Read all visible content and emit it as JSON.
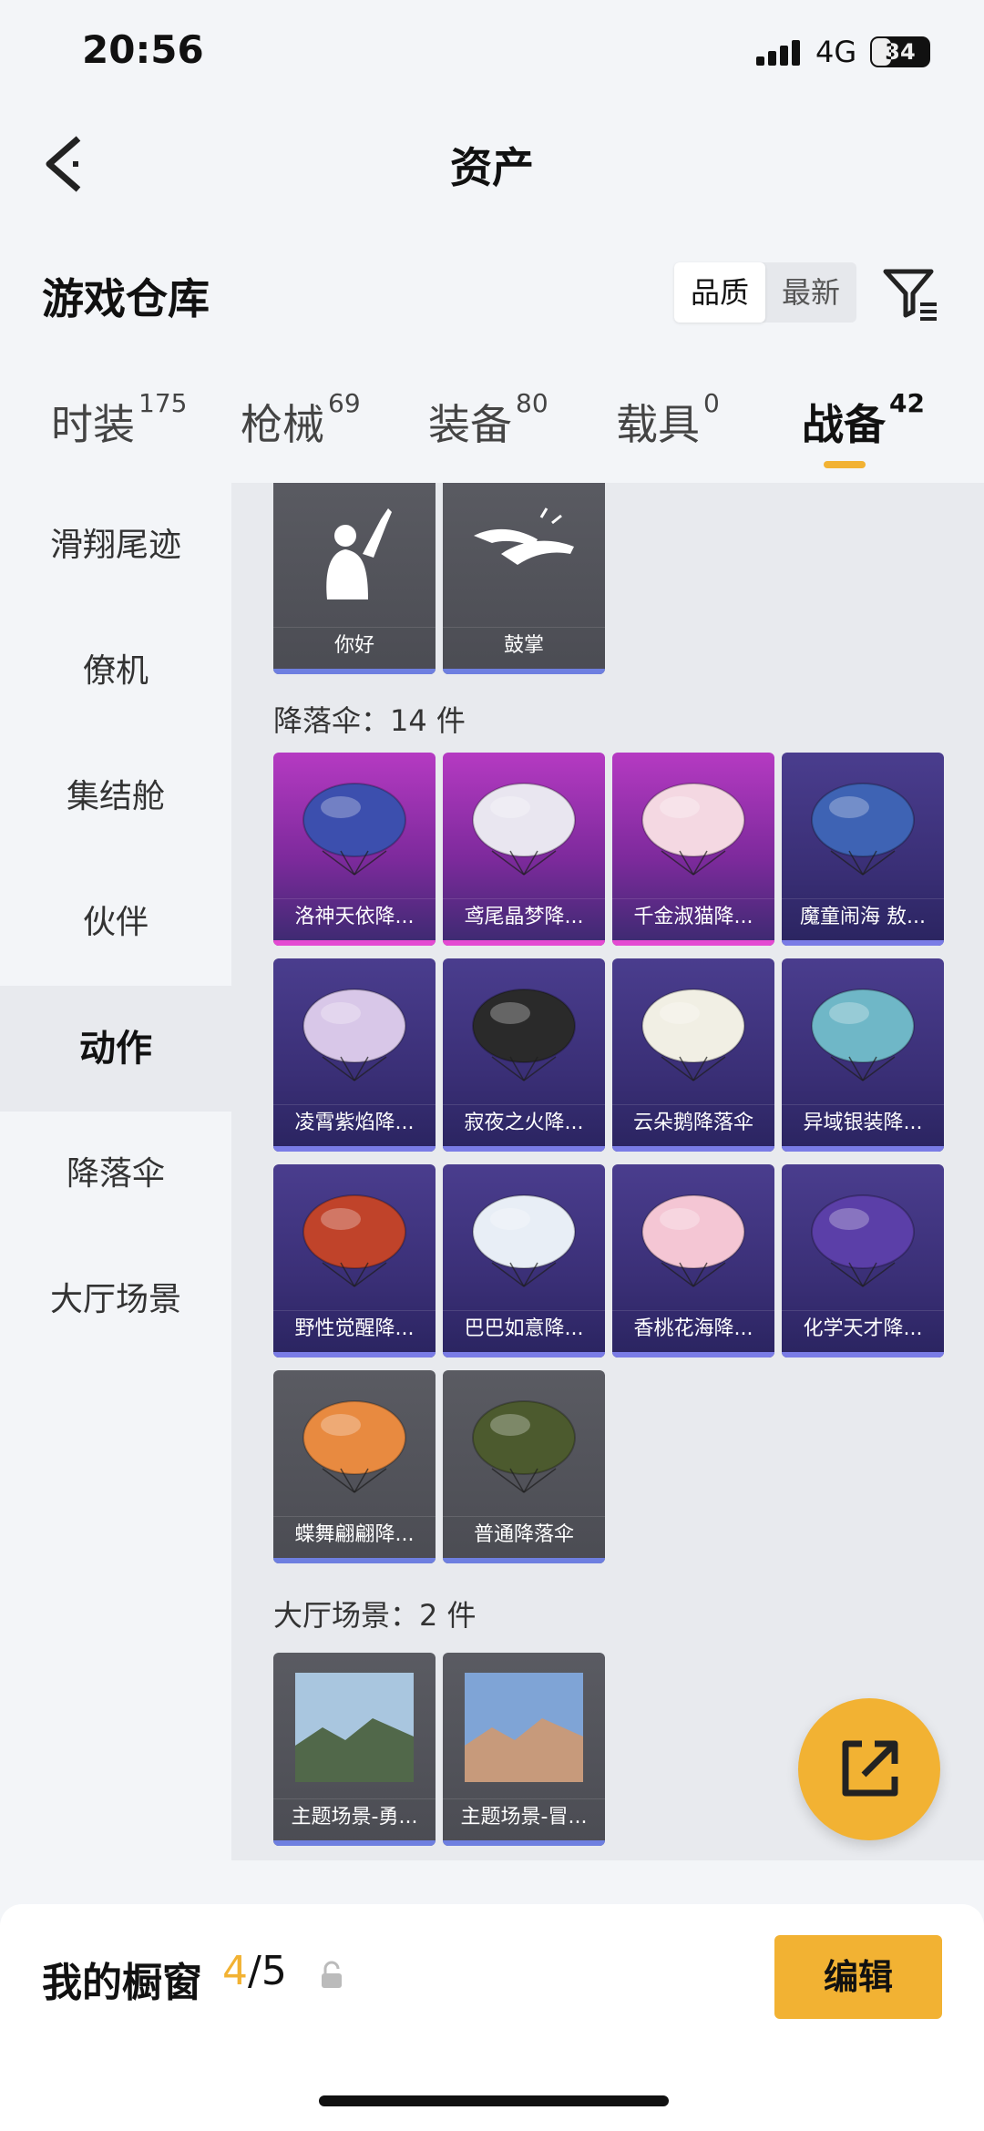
{
  "status": {
    "time": "20:56",
    "network": "4G",
    "battery": "34",
    "battery_level": 0.34
  },
  "nav": {
    "title": "资产",
    "back_icon": "chevron-left-icon"
  },
  "warehouse": {
    "title": "游戏仓库",
    "sort_options": [
      "品质",
      "最新"
    ],
    "sort_selected": "品质",
    "filter_icon": "filter-icon"
  },
  "tabs": [
    {
      "label": "时装",
      "count": "175"
    },
    {
      "label": "枪械",
      "count": "69"
    },
    {
      "label": "装备",
      "count": "80"
    },
    {
      "label": "载具",
      "count": "0"
    },
    {
      "label": "战备",
      "count": "42",
      "active": true
    }
  ],
  "sidebar": [
    {
      "label": "滑翔尾迹"
    },
    {
      "label": "僚机"
    },
    {
      "label": "集结舱"
    },
    {
      "label": "伙伴"
    },
    {
      "label": "动作",
      "active": true
    },
    {
      "label": "降落伞"
    },
    {
      "label": "大厅场景"
    }
  ],
  "actions": [
    {
      "label": "你好",
      "icon": "waving-person-icon"
    },
    {
      "label": "鼓掌",
      "icon": "clapping-hands-icon"
    }
  ],
  "parachutes": {
    "header": "降落伞：14 件",
    "items": [
      {
        "label": "洛神天依降...",
        "rarity": "purple",
        "color": "#3c4fae"
      },
      {
        "label": "鸢尾晶梦降...",
        "rarity": "purple",
        "color": "#e9e6f0"
      },
      {
        "label": "千金淑猫降...",
        "rarity": "purple",
        "color": "#f4d8e2"
      },
      {
        "label": "魔童闹海 敖...",
        "rarity": "blue",
        "color": "#3e63b4"
      },
      {
        "label": "凌霄紫焰降...",
        "rarity": "blue",
        "color": "#d8c7e8"
      },
      {
        "label": "寂夜之火降...",
        "rarity": "blue",
        "color": "#2a2a2a"
      },
      {
        "label": "云朵鹅降落伞",
        "rarity": "blue",
        "color": "#f1efe4"
      },
      {
        "label": "异域银装降...",
        "rarity": "blue",
        "color": "#6fb7c7"
      },
      {
        "label": "野性觉醒降...",
        "rarity": "blue",
        "color": "#c0432a"
      },
      {
        "label": "巴巴如意降...",
        "rarity": "blue",
        "color": "#e8eef6"
      },
      {
        "label": "香桃花海降...",
        "rarity": "blue",
        "color": "#f4c6d4"
      },
      {
        "label": "化学天才降...",
        "rarity": "blue",
        "color": "#5b3fa8"
      },
      {
        "label": "蝶舞翩翩降...",
        "rarity": "gray",
        "color": "#e88a40"
      },
      {
        "label": "普通降落伞",
        "rarity": "gray",
        "color": "#4c5a2e"
      }
    ]
  },
  "scenes": {
    "header": "大厅场景：2 件",
    "items": [
      {
        "label": "主题场景-勇...",
        "rarity": "gray",
        "sky": "#a9c6df",
        "ground": "#51684a"
      },
      {
        "label": "主题场景-冒...",
        "rarity": "gray",
        "sky": "#7fa4d6",
        "ground": "#c79a7b"
      }
    ]
  },
  "fab": {
    "icon": "share-external-icon"
  },
  "showcase": {
    "title": "我的橱窗",
    "current": "4",
    "total": "/5",
    "lock_icon": "lock-icon",
    "edit_label": "编辑"
  },
  "colors": {
    "accent": "#f2b233"
  }
}
